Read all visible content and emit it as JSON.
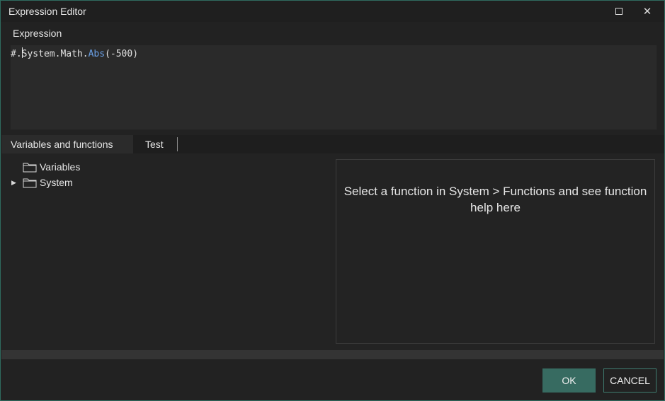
{
  "window": {
    "title": "Expression Editor"
  },
  "expression": {
    "label": "Expression",
    "code_prefix": "#.",
    "code_mid": "System.Math.",
    "code_fn": "Abs",
    "code_suffix": "(-500)"
  },
  "tabs": [
    {
      "label": "Variables and functions",
      "active": true
    },
    {
      "label": "Test",
      "active": false
    }
  ],
  "tree": {
    "items": [
      {
        "label": "Variables",
        "expandable": false
      },
      {
        "label": "System",
        "expandable": true
      }
    ]
  },
  "help": {
    "text": "Select a function in System > Functions and see function help here"
  },
  "buttons": {
    "ok": "OK",
    "cancel": "CANCEL"
  },
  "colors": {
    "accent": "#376b61",
    "function_token": "#6aa0e6"
  }
}
